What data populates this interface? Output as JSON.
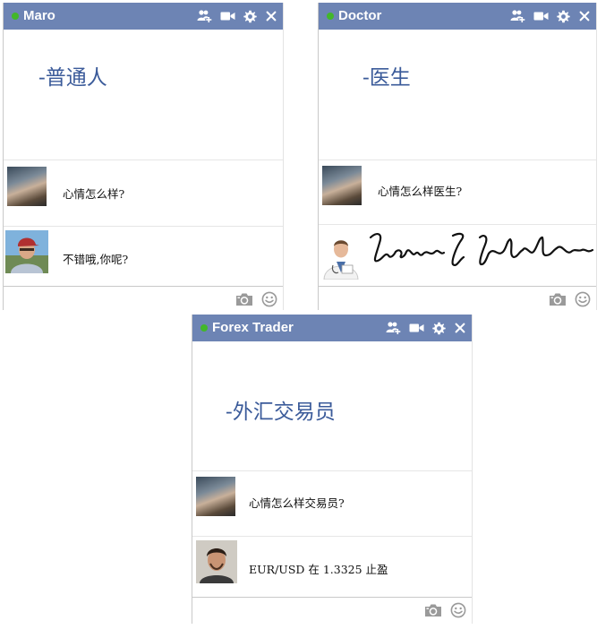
{
  "chats": [
    {
      "name": "Maro",
      "caption": "-普通人",
      "messages": [
        {
          "text": "心情怎么样?",
          "avatar": "pixelated-photo-avatar"
        },
        {
          "text": "不错哦,你呢?",
          "avatar": "man-with-cap-avatar"
        }
      ]
    },
    {
      "name": "Doctor",
      "caption": "-医生",
      "messages": [
        {
          "text": "心情怎么样医生?",
          "avatar": "pixelated-photo-avatar"
        },
        {
          "text": "",
          "avatar": "doctor-avatar",
          "reply": "handwritten-signature-image"
        }
      ]
    },
    {
      "name": "Forex Trader",
      "caption": "-外汇交易员",
      "messages": [
        {
          "text": "心情怎么样交易员?",
          "avatar": "pixelated-photo-avatar"
        },
        {
          "text": "EUR/USD 在 1.3325 止盈",
          "avatar": "young-man-avatar"
        }
      ]
    }
  ],
  "titlebar_icons": [
    "add-friends-icon",
    "video-call-icon",
    "settings-gear-icon",
    "close-icon"
  ],
  "bottombar_icons": [
    "camera-icon",
    "emoticon-icon"
  ],
  "colors": {
    "titlebar": "#6d84b4",
    "online_dot": "#42b72a",
    "caption": "#3b5b9a",
    "divider": "#e6e6e6",
    "icon_gray": "#a0a0a0"
  }
}
